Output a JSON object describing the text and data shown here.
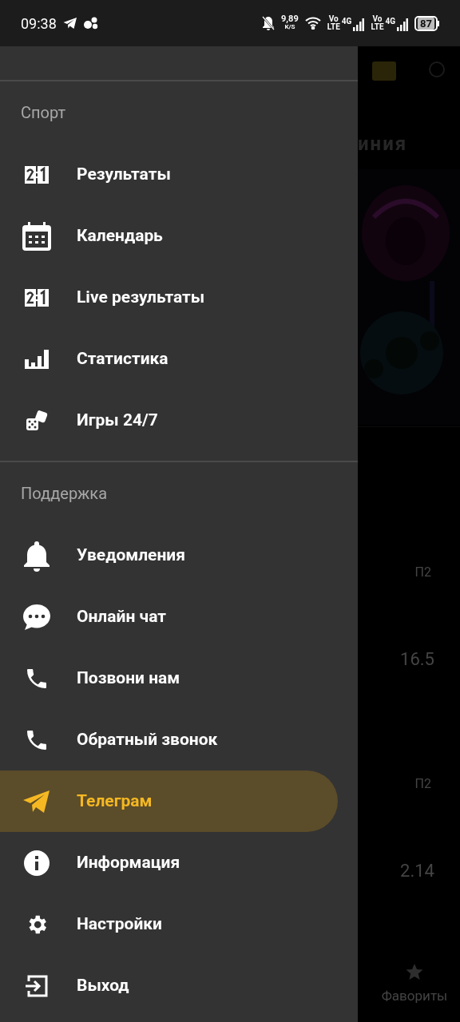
{
  "status_bar": {
    "time": "09:38",
    "net_speed": "9,89",
    "net_unit": "K/S",
    "sim_1": {
      "volte": "Vo",
      "lte": "LTE",
      "network": "4G"
    },
    "sim_2": {
      "volte": "Vo",
      "lte": "LTE",
      "network": "4G"
    },
    "battery": "87"
  },
  "background": {
    "title": "иния",
    "rows": [
      {
        "label": "П2",
        "value": "16.5"
      },
      {
        "label": "П2",
        "value": "2.14"
      }
    ],
    "bottom_tab": "Фавориты"
  },
  "drawer": {
    "sections": [
      {
        "title": "Спорт",
        "items": [
          {
            "label": "Результаты",
            "selected": false
          },
          {
            "label": "Календарь",
            "selected": false
          },
          {
            "label": "Live результаты",
            "selected": false
          },
          {
            "label": "Статистика",
            "selected": false
          },
          {
            "label": "Игры 24/7",
            "selected": false
          }
        ]
      },
      {
        "title": "Поддержка",
        "items": [
          {
            "label": "Уведомления",
            "selected": false
          },
          {
            "label": "Онлайн чат",
            "selected": false
          },
          {
            "label": "Позвони нам",
            "selected": false
          },
          {
            "label": "Обратный звонок",
            "selected": false
          },
          {
            "label": "Телеграм",
            "selected": true
          },
          {
            "label": "Информация",
            "selected": false
          },
          {
            "label": "Настройки",
            "selected": false
          },
          {
            "label": "Выход",
            "selected": false
          }
        ]
      }
    ]
  }
}
